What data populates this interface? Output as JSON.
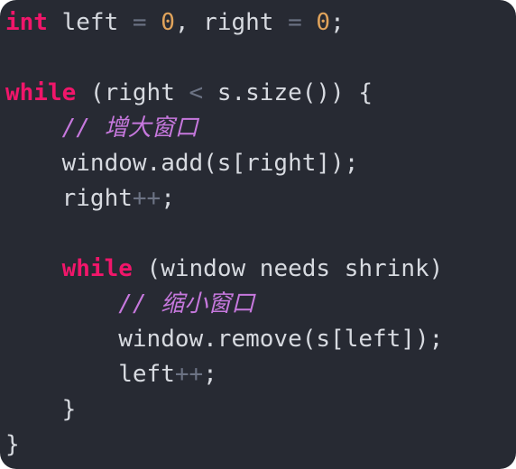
{
  "colors": {
    "background": "#272a33",
    "keyword": "#f0166a",
    "number": "#e0a35b",
    "operator": "#6c7384",
    "comment": "#c678dd",
    "text": "#d7dae0"
  },
  "code": {
    "l1": {
      "kw": "int",
      "a": " left ",
      "op1": "=",
      "b": " ",
      "n1": "0",
      "c": ", right ",
      "op2": "=",
      "d": " ",
      "n2": "0",
      "e": ";"
    },
    "l3": {
      "kw": "while",
      "a": " (right ",
      "op": "<",
      "b": " s.size()) {"
    },
    "l4": {
      "indent": "    ",
      "cmt": "// 增大窗口"
    },
    "l5": {
      "indent": "    ",
      "a": "window.add(s[right]);"
    },
    "l6": {
      "indent": "    ",
      "a": "right",
      "op": "++",
      "b": ";"
    },
    "l8": {
      "indent": "    ",
      "kw": "while",
      "a": " (window needs shrink)"
    },
    "l9": {
      "indent": "        ",
      "cmt": "// 缩小窗口"
    },
    "l10": {
      "indent": "        ",
      "a": "window.remove(s[left]);"
    },
    "l11": {
      "indent": "        ",
      "a": "left",
      "op": "++",
      "b": ";"
    },
    "l12": {
      "indent": "    ",
      "a": "}"
    },
    "l13": {
      "a": "}"
    }
  }
}
